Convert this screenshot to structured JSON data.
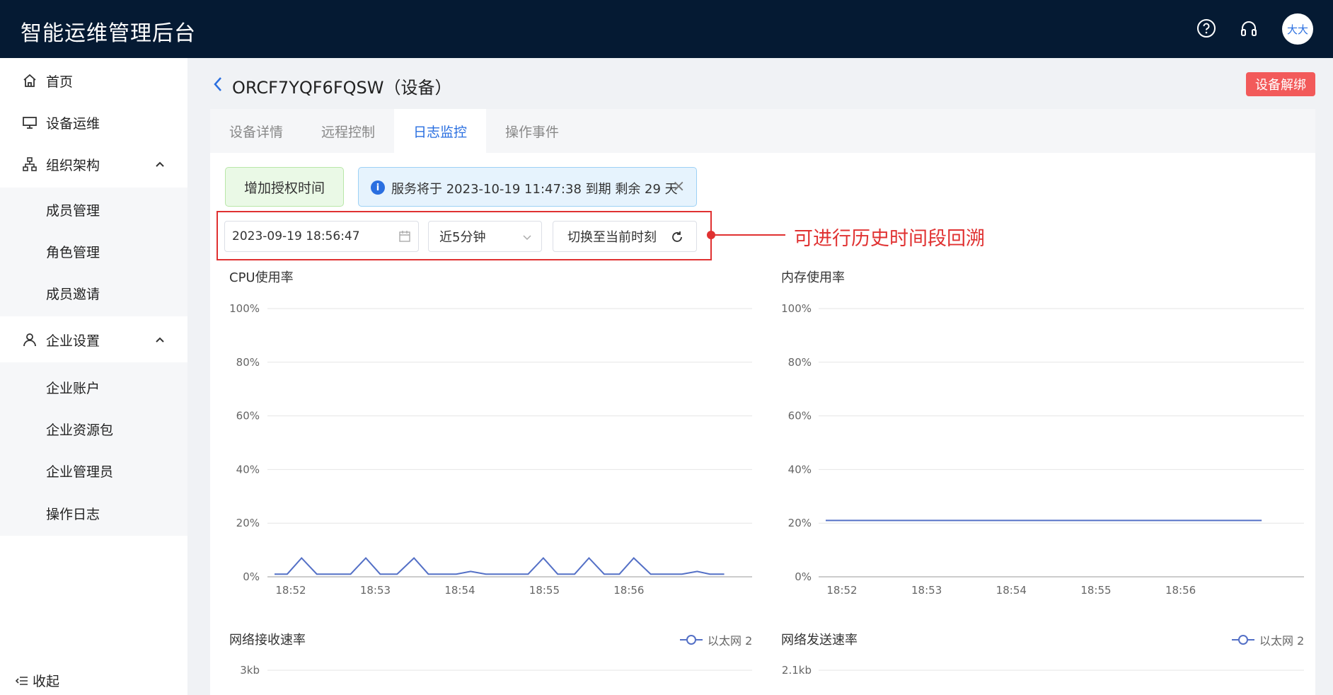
{
  "app": {
    "title": "智能运维管理后台",
    "avatar_text": "大大"
  },
  "header_icons": [
    "help-circle-icon",
    "headset-icon"
  ],
  "sidebar": {
    "items": [
      {
        "label": "首页",
        "icon": "home-icon"
      },
      {
        "label": "设备运维",
        "icon": "monitor-icon"
      },
      {
        "label": "组织架构",
        "icon": "org-chart-icon",
        "expanded": true
      },
      {
        "label": "企业设置",
        "icon": "user-icon",
        "expanded": true
      }
    ],
    "org_sub": [
      "成员管理",
      "角色管理",
      "成员邀请"
    ],
    "ent_sub": [
      "企业账户",
      "企业资源包",
      "企业管理员",
      "操作日志"
    ],
    "collapse_label": "收起"
  },
  "device": {
    "title": "ORCF7YQF6FQSW（设备）",
    "unbind_label": "设备解绑"
  },
  "tabs": [
    {
      "label": "设备详情",
      "active": false
    },
    {
      "label": "远程控制",
      "active": false
    },
    {
      "label": "日志监控",
      "active": true
    },
    {
      "label": "操作事件",
      "active": false
    }
  ],
  "grant_label": "增加授权时间",
  "notice": {
    "text": "服务将于 2023-10-19 11:47:38 到期 剩余 29 天"
  },
  "controls": {
    "date_value": "2023-09-19 18:56:47",
    "range_value": "近5分钟",
    "switch_label": "切换至当前时刻"
  },
  "annotation": "可进行历史时间段回溯",
  "colors": {
    "accent": "#2a6fe0",
    "header_bg": "#051a33",
    "danger": "#f25a5a",
    "annotation": "#e03131",
    "series": "#5470c6"
  },
  "chart_data": [
    {
      "type": "line",
      "title": "CPU使用率",
      "x_ticks": [
        "18:52",
        "18:53",
        "18:54",
        "18:55",
        "18:56"
      ],
      "y_ticks": [
        "100%",
        "80%",
        "60%",
        "40%",
        "20%",
        "0%"
      ],
      "ylim": [
        0,
        100
      ],
      "grid": true,
      "x": [
        0,
        0.15,
        0.32,
        0.5,
        0.72,
        0.9,
        1.08,
        1.25,
        1.45,
        1.65,
        1.82,
        2.0,
        2.15,
        2.32,
        2.5,
        2.7,
        2.85,
        3.0,
        3.18,
        3.35,
        3.55,
        3.72,
        3.9,
        4.08,
        4.25,
        4.45,
        4.62,
        4.82,
        5.0,
        5.15,
        5.32
      ],
      "series": [
        {
          "values": [
            1,
            1,
            7,
            1,
            1,
            1,
            7,
            1,
            1,
            7,
            1,
            1,
            1,
            2,
            1,
            1,
            1,
            1,
            7,
            1,
            1,
            7,
            1,
            1,
            7,
            1,
            1,
            1,
            2,
            1,
            1
          ]
        }
      ]
    },
    {
      "type": "line",
      "title": "内存使用率",
      "x_ticks": [
        "18:52",
        "18:53",
        "18:54",
        "18:55",
        "18:56"
      ],
      "y_ticks": [
        "100%",
        "80%",
        "60%",
        "40%",
        "20%",
        "0%"
      ],
      "ylim": [
        0,
        100
      ],
      "grid": true,
      "x": [
        0,
        5.15
      ],
      "series": [
        {
          "values": [
            21,
            21
          ]
        }
      ]
    },
    {
      "type": "line",
      "title": "网络接收速率",
      "y_ticks": [
        "3kb"
      ],
      "legend": "以太网 2"
    },
    {
      "type": "line",
      "title": "网络发送速率",
      "y_ticks": [
        "2.1kb"
      ],
      "legend": "以太网 2"
    }
  ]
}
